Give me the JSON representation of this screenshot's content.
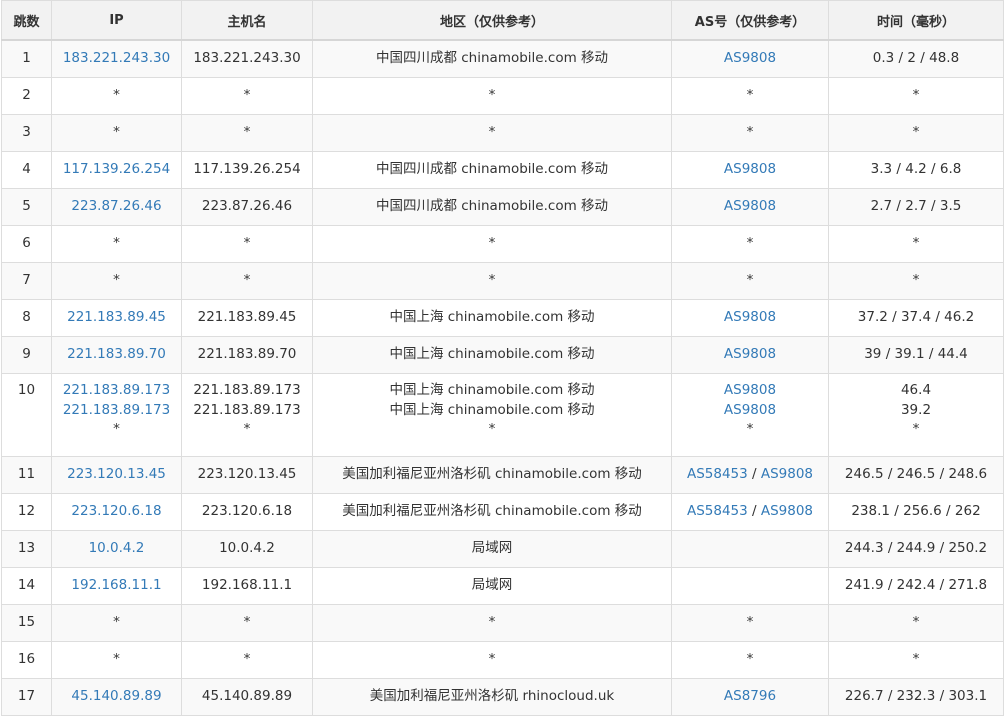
{
  "colors": {
    "link": "#337ab7",
    "text": "#333333",
    "header_bg": "#f2f2f2",
    "stripe": "#f9f9f9",
    "border": "#dddddd"
  },
  "headers": {
    "hop": "跳数",
    "ip": "IP",
    "host": "主机名",
    "region": "地区（仅供参考）",
    "as": "AS号（仅供参考）",
    "time": "时间（毫秒）"
  },
  "rows": [
    {
      "hop": "1",
      "ip": [
        "183.221.243.30"
      ],
      "host": [
        "183.221.243.30"
      ],
      "region": [
        "中国四川成都 chinamobile.com 移动"
      ],
      "as": [
        [
          "AS9808"
        ]
      ],
      "time": [
        "0.3 / 2 / 48.8"
      ]
    },
    {
      "hop": "2",
      "ip": [
        "*"
      ],
      "host": [
        "*"
      ],
      "region": [
        "*"
      ],
      "as": [
        [
          "*"
        ]
      ],
      "time": [
        "*"
      ]
    },
    {
      "hop": "3",
      "ip": [
        "*"
      ],
      "host": [
        "*"
      ],
      "region": [
        "*"
      ],
      "as": [
        [
          "*"
        ]
      ],
      "time": [
        "*"
      ]
    },
    {
      "hop": "4",
      "ip": [
        "117.139.26.254"
      ],
      "host": [
        "117.139.26.254"
      ],
      "region": [
        "中国四川成都 chinamobile.com 移动"
      ],
      "as": [
        [
          "AS9808"
        ]
      ],
      "time": [
        "3.3 / 4.2 / 6.8"
      ]
    },
    {
      "hop": "5",
      "ip": [
        "223.87.26.46"
      ],
      "host": [
        "223.87.26.46"
      ],
      "region": [
        "中国四川成都 chinamobile.com 移动"
      ],
      "as": [
        [
          "AS9808"
        ]
      ],
      "time": [
        "2.7 / 2.7 / 3.5"
      ]
    },
    {
      "hop": "6",
      "ip": [
        "*"
      ],
      "host": [
        "*"
      ],
      "region": [
        "*"
      ],
      "as": [
        [
          "*"
        ]
      ],
      "time": [
        "*"
      ]
    },
    {
      "hop": "7",
      "ip": [
        "*"
      ],
      "host": [
        "*"
      ],
      "region": [
        "*"
      ],
      "as": [
        [
          "*"
        ]
      ],
      "time": [
        "*"
      ]
    },
    {
      "hop": "8",
      "ip": [
        "221.183.89.45"
      ],
      "host": [
        "221.183.89.45"
      ],
      "region": [
        "中国上海 chinamobile.com 移动"
      ],
      "as": [
        [
          "AS9808"
        ]
      ],
      "time": [
        "37.2 / 37.4 / 46.2"
      ]
    },
    {
      "hop": "9",
      "ip": [
        "221.183.89.70"
      ],
      "host": [
        "221.183.89.70"
      ],
      "region": [
        "中国上海 chinamobile.com 移动"
      ],
      "as": [
        [
          "AS9808"
        ]
      ],
      "time": [
        "39 / 39.1 / 44.4"
      ]
    },
    {
      "hop": "10",
      "ip": [
        "221.183.89.173",
        "221.183.89.173",
        "*"
      ],
      "host": [
        "221.183.89.173",
        "221.183.89.173",
        "*"
      ],
      "region": [
        "中国上海 chinamobile.com 移动",
        "中国上海 chinamobile.com 移动",
        "*"
      ],
      "as": [
        [
          "AS9808"
        ],
        [
          "AS9808"
        ],
        [
          "*"
        ]
      ],
      "time": [
        "46.4",
        "39.2",
        "*"
      ]
    },
    {
      "hop": "11",
      "ip": [
        "223.120.13.45"
      ],
      "host": [
        "223.120.13.45"
      ],
      "region": [
        "美国加利福尼亚州洛杉矶 chinamobile.com 移动"
      ],
      "as": [
        [
          "AS58453",
          "AS9808"
        ]
      ],
      "time": [
        "246.5 / 246.5 / 248.6"
      ]
    },
    {
      "hop": "12",
      "ip": [
        "223.120.6.18"
      ],
      "host": [
        "223.120.6.18"
      ],
      "region": [
        "美国加利福尼亚州洛杉矶 chinamobile.com 移动"
      ],
      "as": [
        [
          "AS58453",
          "AS9808"
        ]
      ],
      "time": [
        "238.1 / 256.6 / 262"
      ]
    },
    {
      "hop": "13",
      "ip": [
        "10.0.4.2"
      ],
      "host": [
        "10.0.4.2"
      ],
      "region": [
        "局域网"
      ],
      "as": [
        []
      ],
      "time": [
        "244.3 / 244.9 / 250.2"
      ]
    },
    {
      "hop": "14",
      "ip": [
        "192.168.11.1"
      ],
      "host": [
        "192.168.11.1"
      ],
      "region": [
        "局域网"
      ],
      "as": [
        []
      ],
      "time": [
        "241.9 / 242.4 / 271.8"
      ]
    },
    {
      "hop": "15",
      "ip": [
        "*"
      ],
      "host": [
        "*"
      ],
      "region": [
        "*"
      ],
      "as": [
        [
          "*"
        ]
      ],
      "time": [
        "*"
      ]
    },
    {
      "hop": "16",
      "ip": [
        "*"
      ],
      "host": [
        "*"
      ],
      "region": [
        "*"
      ],
      "as": [
        [
          "*"
        ]
      ],
      "time": [
        "*"
      ]
    },
    {
      "hop": "17",
      "ip": [
        "45.140.89.89"
      ],
      "host": [
        "45.140.89.89"
      ],
      "region": [
        "美国加利福尼亚州洛杉矶 rhinocloud.uk"
      ],
      "as": [
        [
          "AS8796"
        ]
      ],
      "time": [
        "226.7 / 232.3 / 303.1"
      ]
    }
  ]
}
